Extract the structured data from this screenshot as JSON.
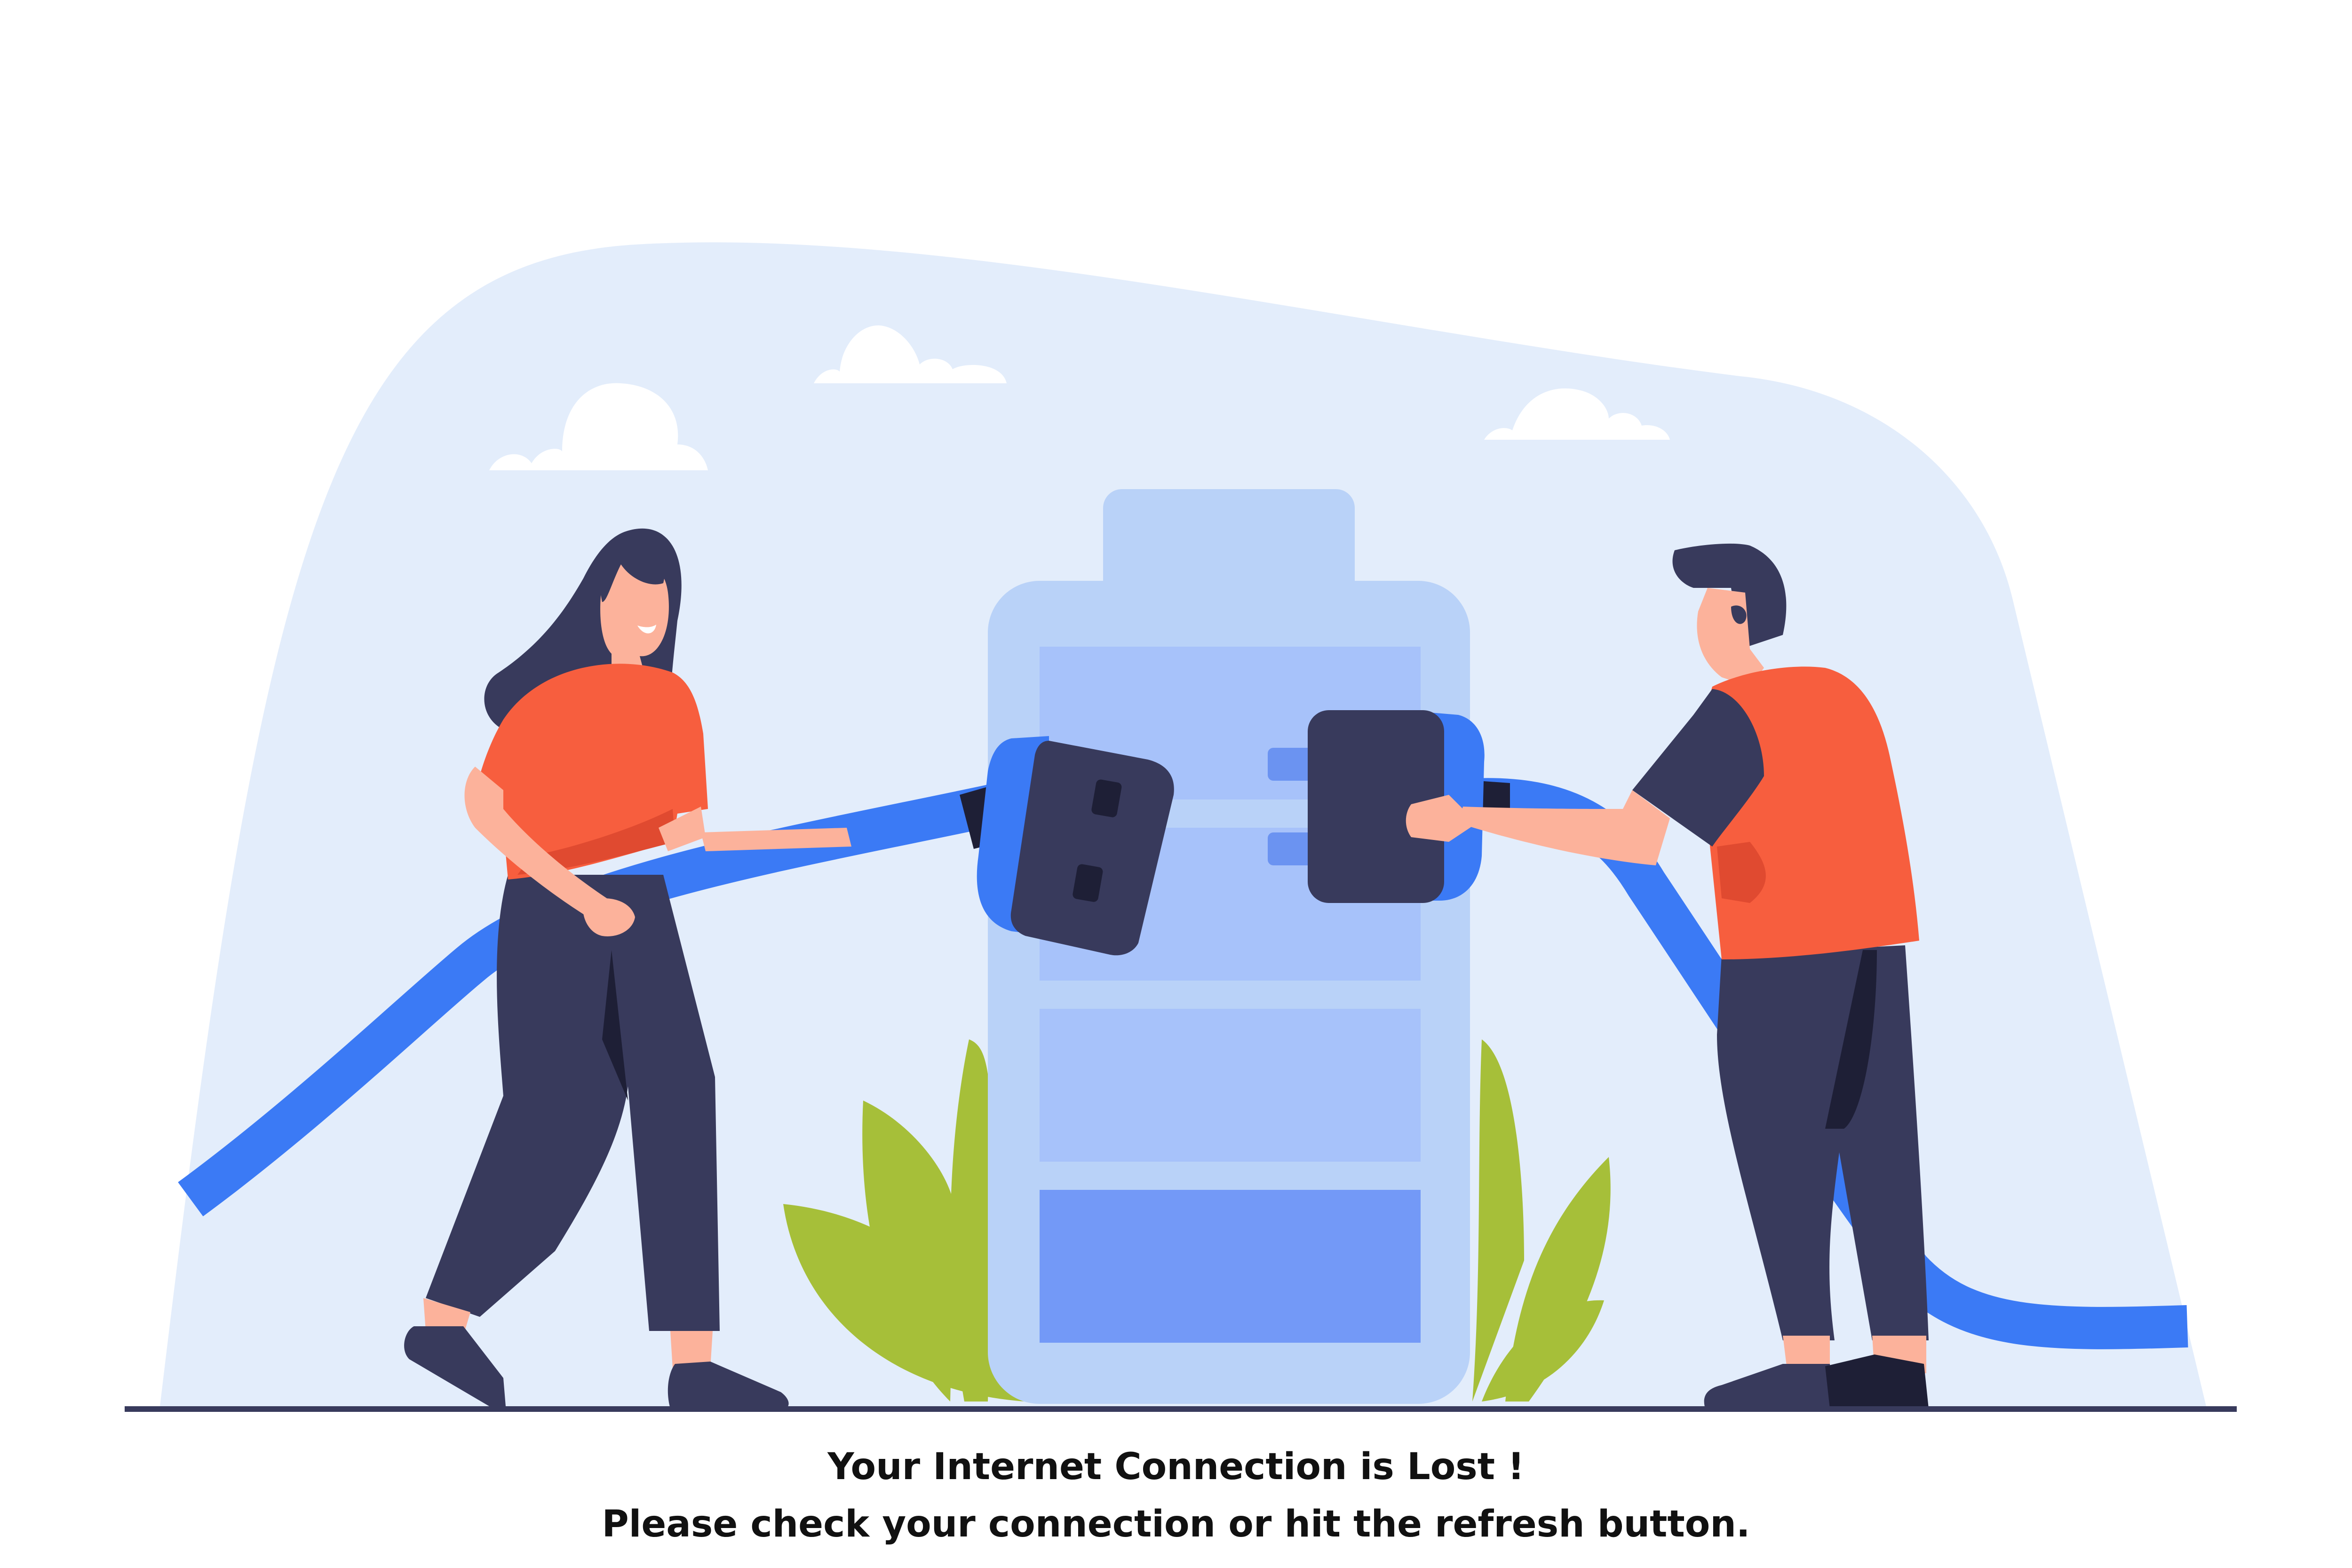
{
  "message": {
    "title": "Your Internet Connection is Lost !",
    "body": "Please check your connection or hit the refresh button."
  },
  "colors": {
    "background": "#ffffff",
    "sky_blob": "#e3edfb",
    "cloud": "#ffffff",
    "battery_shell": "#b9d2f8",
    "battery_cell_light": "#a7c2fa",
    "battery_cell_dark": "#7399f7",
    "cable": "#3b7af5",
    "plug": "#383a5c",
    "plug_pins": "#6b93f1",
    "shirt": "#f75e3e",
    "pants": "#383a5c",
    "skin": "#fcb29b",
    "leaf": "#a6bf39",
    "ground_line": "#383a5c",
    "text": "#111111"
  },
  "icons": {
    "cloud_left": "cloud-icon",
    "cloud_center": "cloud-icon",
    "cloud_right": "cloud-icon",
    "battery": "battery-icon",
    "socket_plug": "socket-plug-icon",
    "power_plug": "power-plug-icon"
  }
}
